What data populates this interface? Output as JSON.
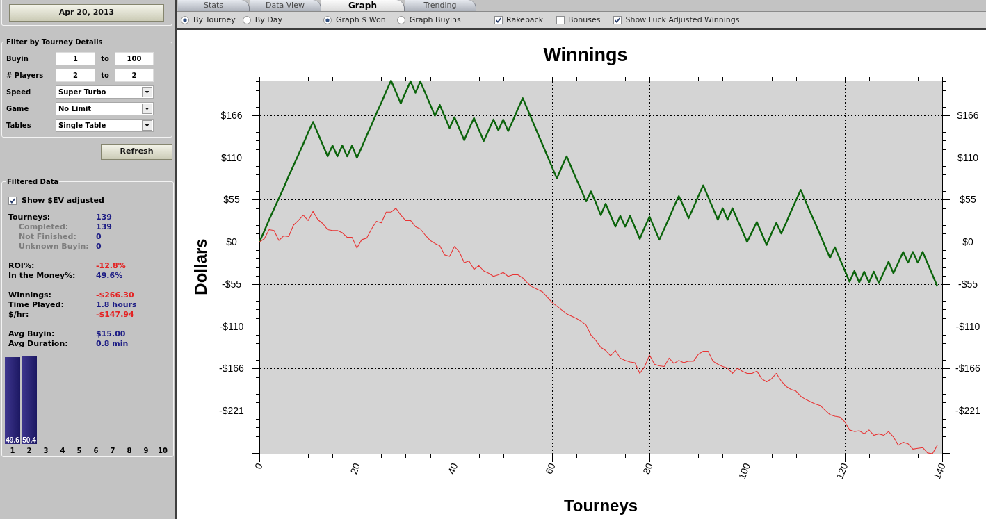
{
  "sidebar": {
    "date_button": "Apr 20, 2013",
    "filter_panel": {
      "title": "Filter by Tourney Details",
      "ranges": [
        {
          "label": "Buyin",
          "from": "1",
          "connector": "to",
          "to": "100"
        },
        {
          "label": "# Players",
          "from": "2",
          "connector": "to",
          "to": "2"
        }
      ],
      "dropdowns": [
        {
          "label": "Speed",
          "value": "Super Turbo"
        },
        {
          "label": "Game",
          "value": "No Limit"
        },
        {
          "label": "Tables",
          "value": "Single Table"
        }
      ]
    },
    "refresh_button": "Refresh",
    "filtered_data": {
      "title": "Filtered Data",
      "ev_checkbox": {
        "label": "Show $EV adjusted",
        "checked": true
      },
      "stat_groups": [
        {
          "items": [
            {
              "label": "Tourneys:",
              "value": "139",
              "color": "#1c1c84",
              "children": [
                {
                  "label": "Completed:",
                  "value": "139",
                  "color": "#1c1c84"
                },
                {
                  "label": "Not Finished:",
                  "value": "0",
                  "color": "#1c1c84"
                },
                {
                  "label": "Unknown Buyin:",
                  "value": "0",
                  "color": "#1c1c84"
                }
              ]
            }
          ]
        },
        {
          "items": [
            {
              "label": "ROI%:",
              "value": "-12.8%",
              "color": "#e42222"
            },
            {
              "label": "In the Money%:",
              "value": "49.6%",
              "color": "#1c1c84"
            }
          ]
        },
        {
          "items": [
            {
              "label": "Winnings:",
              "value": "-$266.30",
              "color": "#e42222"
            },
            {
              "label": "Time Played:",
              "value": "1.8 hours",
              "color": "#1c1c84"
            },
            {
              "label": "$/hr:",
              "value": "-$147.94",
              "color": "#e42222"
            }
          ]
        },
        {
          "items": [
            {
              "label": "Avg Buyin:",
              "value": "$15.00",
              "color": "#1c1c84"
            },
            {
              "label": "Avg Duration:",
              "value": "0.8 min",
              "color": "#1c1c84"
            }
          ]
        }
      ],
      "histogram": {
        "chart_data": {
          "type": "bar",
          "categories": [
            "1",
            "2",
            "3",
            "4",
            "5",
            "6",
            "7",
            "8",
            "9",
            "10"
          ],
          "values": [
            49.6,
            50.4,
            0,
            0,
            0,
            0,
            0,
            0,
            0,
            0
          ],
          "ylim": [
            0,
            50.4
          ],
          "value_labels": [
            "49.6",
            "50.4",
            null,
            null,
            null,
            null,
            null,
            null,
            null,
            null
          ]
        }
      }
    }
  },
  "tabs": [
    {
      "label": "Stats",
      "selected": false
    },
    {
      "label": "Data View",
      "selected": false
    },
    {
      "label": "Graph",
      "selected": true
    },
    {
      "label": "Trending",
      "selected": false
    }
  ],
  "toolbar": {
    "radio_groups": [
      {
        "options": [
          {
            "label": "By Tourney",
            "selected": true
          },
          {
            "label": "By Day",
            "selected": false
          }
        ]
      },
      {
        "options": [
          {
            "label": "Graph $ Won",
            "selected": true
          },
          {
            "label": "Graph Buyins",
            "selected": false
          }
        ]
      }
    ],
    "checkboxes": [
      {
        "label": "Rakeback",
        "checked": true
      },
      {
        "label": "Bonuses",
        "checked": false
      },
      {
        "label": "Show Luck Adjusted Winnings",
        "checked": true
      }
    ]
  },
  "graph": {
    "chart_data": {
      "type": "line",
      "title": "Winnings",
      "xlabel": "Tourneys",
      "ylabel": "Dollars",
      "x": [
        0,
        1,
        2,
        3,
        4,
        5,
        6,
        7,
        8,
        9,
        10,
        11,
        12,
        13,
        14,
        15,
        16,
        17,
        18,
        19,
        20,
        21,
        22,
        23,
        24,
        25,
        26,
        27,
        28,
        29,
        30,
        31,
        32,
        33,
        34,
        35,
        36,
        37,
        38,
        39,
        40,
        41,
        42,
        43,
        44,
        45,
        46,
        47,
        48,
        49,
        50,
        51,
        52,
        53,
        54,
        55,
        56,
        57,
        58,
        59,
        60,
        61,
        62,
        63,
        64,
        65,
        66,
        67,
        68,
        69,
        70,
        71,
        72,
        73,
        74,
        75,
        76,
        77,
        78,
        79,
        80,
        81,
        82,
        83,
        84,
        85,
        86,
        87,
        88,
        89,
        90,
        91,
        92,
        93,
        94,
        95,
        96,
        97,
        98,
        99,
        100,
        101,
        102,
        103,
        104,
        105,
        106,
        107,
        108,
        109,
        110,
        111,
        112,
        113,
        114,
        115,
        116,
        117,
        118,
        119,
        120,
        121,
        122,
        123,
        124,
        125,
        126,
        127,
        128,
        129,
        130,
        131,
        132,
        133,
        134,
        135,
        136,
        137,
        138,
        139
      ],
      "series": [
        {
          "color": "#0b640b",
          "values": [
            0,
            14,
            29,
            43,
            57,
            71,
            86,
            100,
            114,
            128,
            143,
            157,
            142,
            127,
            112,
            126,
            112,
            126,
            112,
            126,
            110,
            124,
            139,
            153,
            168,
            182,
            197,
            211,
            196,
            181,
            196,
            210,
            195,
            210,
            195,
            180,
            165,
            179,
            164,
            149,
            163,
            148,
            133,
            148,
            162,
            147,
            132,
            146,
            160,
            146,
            160,
            145,
            159,
            174,
            188,
            173,
            158,
            143,
            128,
            113,
            98,
            83,
            98,
            112,
            97,
            82,
            68,
            53,
            66,
            51,
            35,
            50,
            35,
            20,
            34,
            20,
            34,
            19,
            4,
            19,
            33,
            18,
            3,
            17,
            31,
            46,
            60,
            46,
            31,
            45,
            60,
            74,
            59,
            44,
            29,
            44,
            29,
            44,
            29,
            15,
            0,
            13,
            26,
            11,
            -4,
            11,
            25,
            11,
            25,
            40,
            54,
            68,
            53,
            38,
            24,
            9,
            -6,
            -21,
            -7,
            -22,
            -37,
            -52,
            -38,
            -53,
            -39,
            -53,
            -39,
            -54,
            -40,
            -26,
            -41,
            -27,
            -13,
            -27,
            -13,
            -27,
            -13,
            -28,
            -43,
            -58
          ]
        },
        {
          "color": "#e83434",
          "values": [
            0,
            4,
            16,
            15,
            2,
            8,
            7,
            22,
            28,
            35,
            28,
            40,
            29,
            24,
            16,
            15,
            15,
            12,
            6,
            6,
            -8,
            3,
            5,
            17,
            27,
            25,
            39,
            39,
            44,
            35,
            28,
            28,
            20,
            17,
            9,
            2,
            -2,
            -5,
            -17,
            -19,
            -6,
            -13,
            -27,
            -25,
            -36,
            -31,
            -38,
            -41,
            -45,
            -43,
            -40,
            -45,
            -43,
            -43,
            -47,
            -54,
            -59,
            -62,
            -65,
            -72,
            -79,
            -84,
            -89,
            -94,
            -97,
            -100,
            -104,
            -109,
            -122,
            -129,
            -138,
            -142,
            -149,
            -142,
            -152,
            -155,
            -157,
            -158,
            -172,
            -163,
            -148,
            -160,
            -162,
            -163,
            -152,
            -159,
            -155,
            -158,
            -156,
            -156,
            -147,
            -143,
            -143,
            -156,
            -160,
            -163,
            -165,
            -172,
            -165,
            -169,
            -172,
            -172,
            -169,
            -179,
            -183,
            -179,
            -172,
            -182,
            -189,
            -193,
            -195,
            -202,
            -206,
            -209,
            -212,
            -214,
            -220,
            -226,
            -228,
            -229,
            -235,
            -246,
            -248,
            -247,
            -251,
            -246,
            -253,
            -251,
            -253,
            -248,
            -255,
            -266,
            -262,
            -264,
            -271,
            -270,
            -269,
            -276,
            -277,
            -266
          ]
        }
      ],
      "xlim": [
        0,
        140
      ],
      "ylim": [
        -277,
        211
      ],
      "xticks": [
        0,
        20,
        40,
        60,
        80,
        100,
        120,
        140
      ],
      "yticks": [
        {
          "value": -220.8,
          "label": "-$221"
        },
        {
          "value": -165.6,
          "label": "-$166"
        },
        {
          "value": -110.4,
          "label": "-$110"
        },
        {
          "value": -55.2,
          "label": "-$55"
        },
        {
          "value": 0,
          "label": "$0"
        },
        {
          "value": 55.2,
          "label": "$55"
        },
        {
          "value": 110.4,
          "label": "$110"
        },
        {
          "value": 165.6,
          "label": "$166"
        }
      ],
      "grid": true
    },
    "right_axis_labels": [
      "$166",
      "$110",
      "$55",
      "$0",
      "-$55",
      "-$110",
      "-$166",
      "-$221"
    ]
  }
}
